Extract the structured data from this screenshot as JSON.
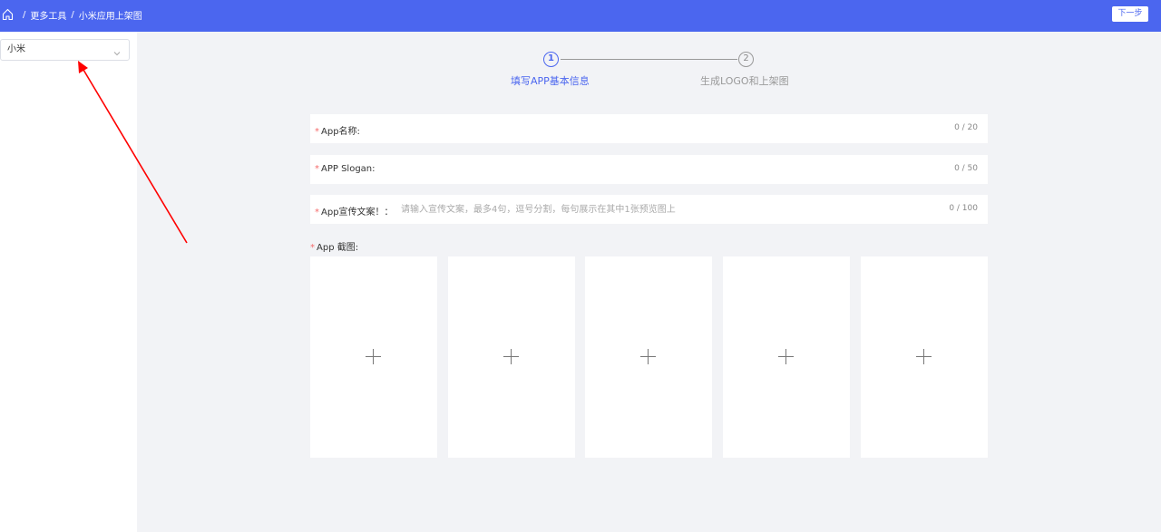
{
  "breadcrumb": {
    "items": [
      "更多工具",
      "小米应用上架图"
    ],
    "separator": "/"
  },
  "header": {
    "next_label": "下一步"
  },
  "sidebar": {
    "select_value": "小米"
  },
  "steps": {
    "step1": {
      "number": "1",
      "label": "填写APP基本信息"
    },
    "step2": {
      "number": "2",
      "label": "生成LOGO和上架图"
    }
  },
  "form": {
    "required_mark": "*",
    "app_name": {
      "label": "App名称:",
      "count": "0 / 20"
    },
    "slogan": {
      "label": "APP Slogan:",
      "count": "0 / 50"
    },
    "promo": {
      "label": "App宣传文案！：",
      "placeholder": "请输入宣传文案，最多4句，逗号分割，每句展示在其中1张预览图上",
      "count": "0 / 100"
    },
    "screenshots": {
      "label": "App 截图:"
    }
  },
  "colors": {
    "accent": "#4b66ef",
    "required": "#f56c6c",
    "annotation_arrow": "#ff0000"
  }
}
